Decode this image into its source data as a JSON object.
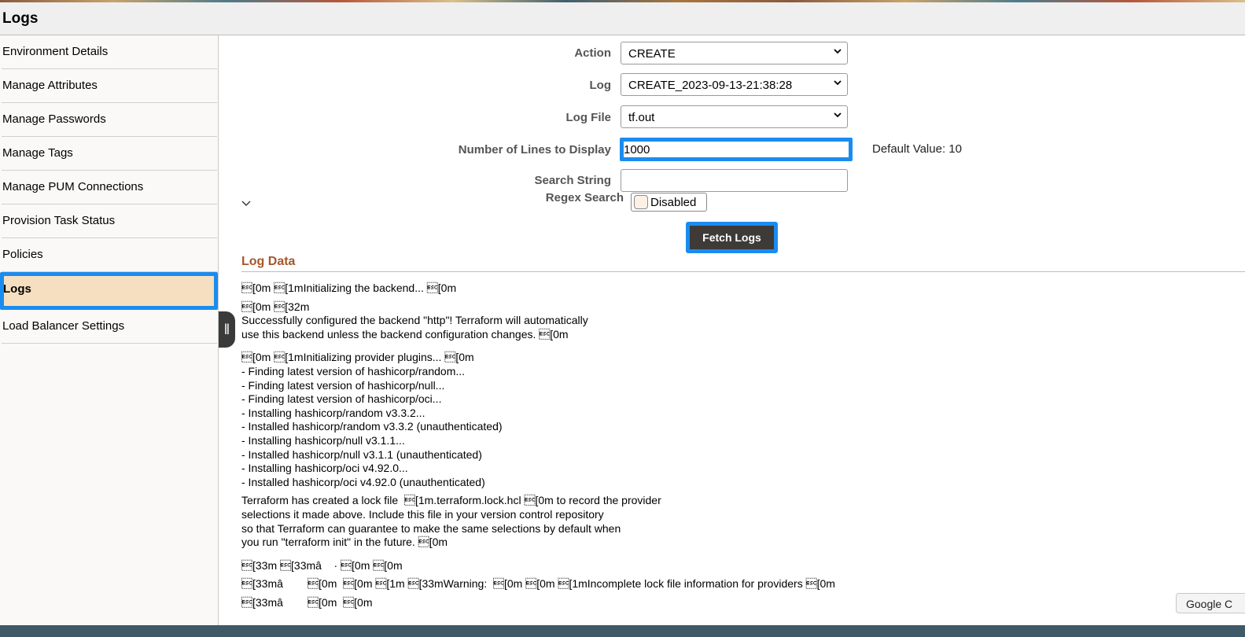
{
  "header": {
    "title": "Logs"
  },
  "sidebar": {
    "items": [
      {
        "label": "Environment Details"
      },
      {
        "label": "Manage Attributes"
      },
      {
        "label": "Manage Passwords"
      },
      {
        "label": "Manage Tags"
      },
      {
        "label": "Manage PUM Connections"
      },
      {
        "label": "Provision Task Status"
      },
      {
        "label": "Policies"
      },
      {
        "label": "Logs",
        "active": true
      },
      {
        "label": "Load Balancer Settings"
      }
    ]
  },
  "form": {
    "action": {
      "label": "Action",
      "value": "CREATE"
    },
    "log": {
      "label": "Log",
      "value": "CREATE_2023-09-13-21:38:28"
    },
    "log_file": {
      "label": "Log File",
      "value": "tf.out"
    },
    "lines": {
      "label": "Number of Lines to Display",
      "value": "1000",
      "hint": "Default Value: 10"
    },
    "search": {
      "label": "Search String",
      "value": ""
    },
    "regex": {
      "label": "Regex Search",
      "state": "Disabled"
    },
    "fetch_label": "Fetch Logs"
  },
  "log_section": {
    "title": "Log Data",
    "lines": [
      "\u001b[0m \u001b[1mInitializing the backend... \u001b[0m",
      "",
      "\u001b[0m \u001b[32m",
      "Successfully configured the backend \"http\"! Terraform will automatically",
      "use this backend unless the backend configuration changes. \u001b[0m",
      "",
      "",
      "\u001b[0m \u001b[1mInitializing provider plugins... \u001b[0m",
      "- Finding latest version of hashicorp/random...",
      "- Finding latest version of hashicorp/null...",
      "- Finding latest version of hashicorp/oci...",
      "- Installing hashicorp/random v3.3.2...",
      "- Installed hashicorp/random v3.3.2 (unauthenticated)",
      "- Installing hashicorp/null v3.1.1...",
      "- Installed hashicorp/null v3.1.1 (unauthenticated)",
      "- Installing hashicorp/oci v4.92.0...",
      "- Installed hashicorp/oci v4.92.0 (unauthenticated)",
      "",
      "Terraform has created a lock file  \u001b[1m.terraform.lock.hcl \u001b[0m to record the provider",
      "selections it made above. Include this file in your version control repository",
      "so that Terraform can guarantee to make the same selections by default when",
      "you run \"terraform init\" in the future. \u001b[0m",
      "",
      "",
      "\u001b[33m \u001b[33mâ    · \u001b[0m \u001b[0m",
      "",
      "\u001b[33mâ        \u001b[0m  \u001b[0m \u001b[1m \u001b[33mWarning:  \u001b[0m \u001b[0m \u001b[1mIncomplete lock file information for providers \u001b[0m",
      "",
      "\u001b[33mâ        \u001b[0m  \u001b[0m"
    ]
  },
  "floating": {
    "google_label": "Google C"
  }
}
